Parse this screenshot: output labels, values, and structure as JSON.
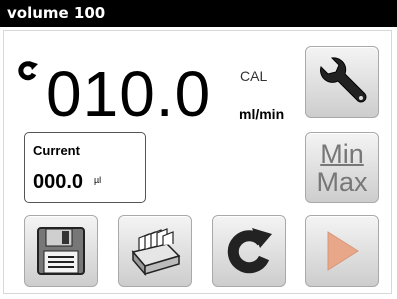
{
  "window": {
    "title": "volume 100"
  },
  "display": {
    "flow_rate": "010.0",
    "cal_label": "CAL",
    "unit": "ml/min",
    "mode_icon": "refresh-icon"
  },
  "current": {
    "label": "Current",
    "value": "000.0",
    "unit": "µl"
  },
  "buttons": {
    "settings_icon": "wrench-icon",
    "minmax": {
      "min": "Min",
      "max": "Max"
    },
    "save_icon": "floppy-disk-icon",
    "library_icon": "card-file-icon",
    "refresh_icon": "refresh-icon",
    "play_icon": "play-icon"
  },
  "colors": {
    "titlebar": "#000000",
    "button_face": "#dcdcdc",
    "disabled_text": "#777777",
    "play_arrow": "#e9a78a"
  }
}
